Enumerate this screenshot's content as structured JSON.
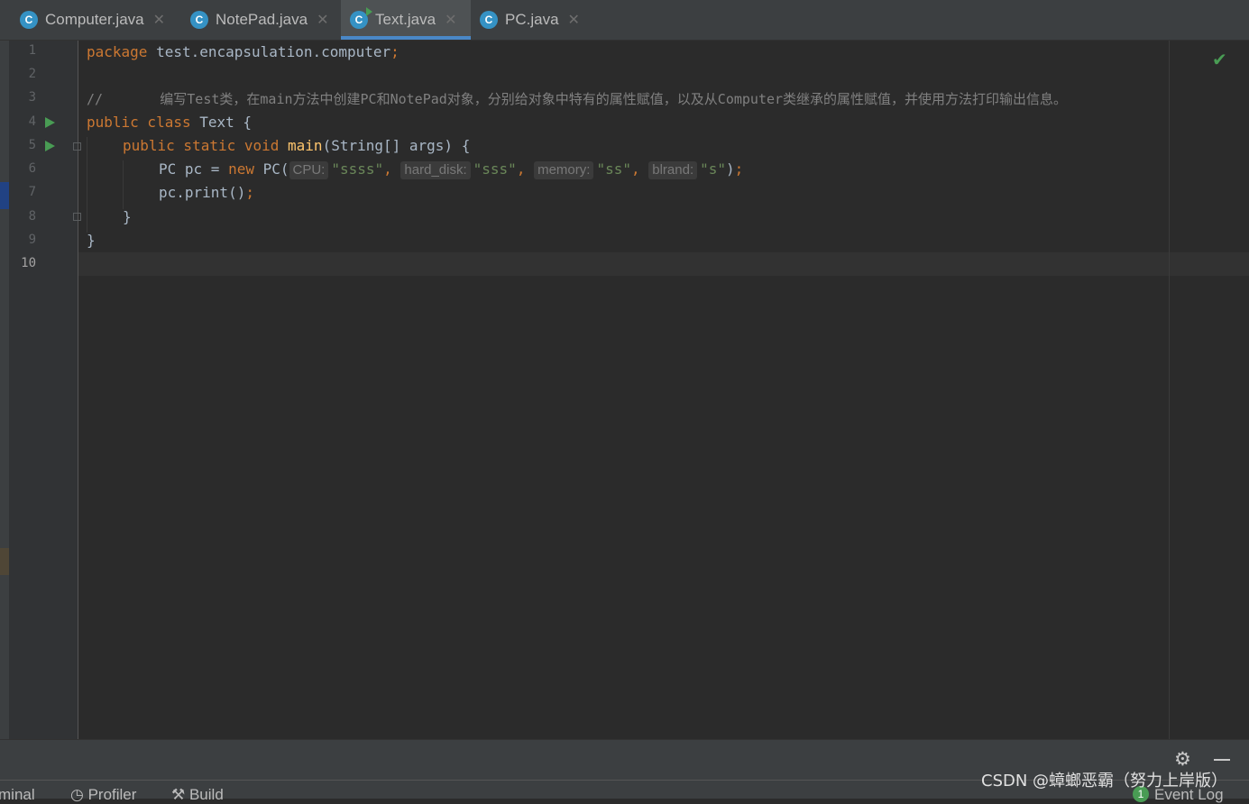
{
  "tabs": [
    {
      "label": "Computer.java",
      "icon": "class-icon",
      "close": "✕"
    },
    {
      "label": "NotePad.java",
      "icon": "class-icon",
      "close": "✕"
    },
    {
      "label": "Text.java",
      "icon": "runnable-class-icon",
      "close": "✕",
      "active": true
    },
    {
      "label": "PC.java",
      "icon": "class-icon",
      "close": "✕"
    }
  ],
  "icon_letter": "C",
  "line_numbers": [
    "1",
    "2",
    "3",
    "4",
    "5",
    "6",
    "7",
    "8",
    "9",
    "10"
  ],
  "code": {
    "l1": {
      "kw": "package",
      "rest": " test.encapsulation.computer",
      "semi": ";"
    },
    "l3": {
      "comment": "//       编写Test类，在main方法中创建PC和NotePad对象，分别给对象中特有的属性赋值，以及从Computer类继承的属性赋值，并使用方法打印输出信息。"
    },
    "l4": {
      "kw": "public class",
      "rest": " Text {"
    },
    "l5": {
      "kw": "public static void",
      "fn": "main",
      "rest": "(String[] args) {"
    },
    "l6": {
      "pre": "PC pc = ",
      "kw": "new",
      "ctor": " PC(",
      "args": [
        {
          "hint": "CPU:",
          "value": "\"ssss\""
        },
        {
          "hint": "hard_disk:",
          "value": "\"sss\""
        },
        {
          "hint": "memory:",
          "value": "\"ss\""
        },
        {
          "hint": "blrand:",
          "value": "\"s\""
        }
      ],
      "comma": ",",
      "close": ")",
      "semi": ";"
    },
    "l7": {
      "text": "pc.print()",
      "semi": ";"
    },
    "l8": {
      "text": "}"
    },
    "l9": {
      "text": "}"
    }
  },
  "status": {
    "terminal": "minal",
    "profiler": "Profiler",
    "build": "Build",
    "event_count": "1",
    "event_log": "Event Log"
  },
  "watermark": "CSDN @蟑螂恶霸（努力上岸版）",
  "colors": {
    "keyword": "#cc7832",
    "string": "#6a8759",
    "comment": "#808080",
    "accent": "#4a88c7",
    "run": "#499c54"
  }
}
